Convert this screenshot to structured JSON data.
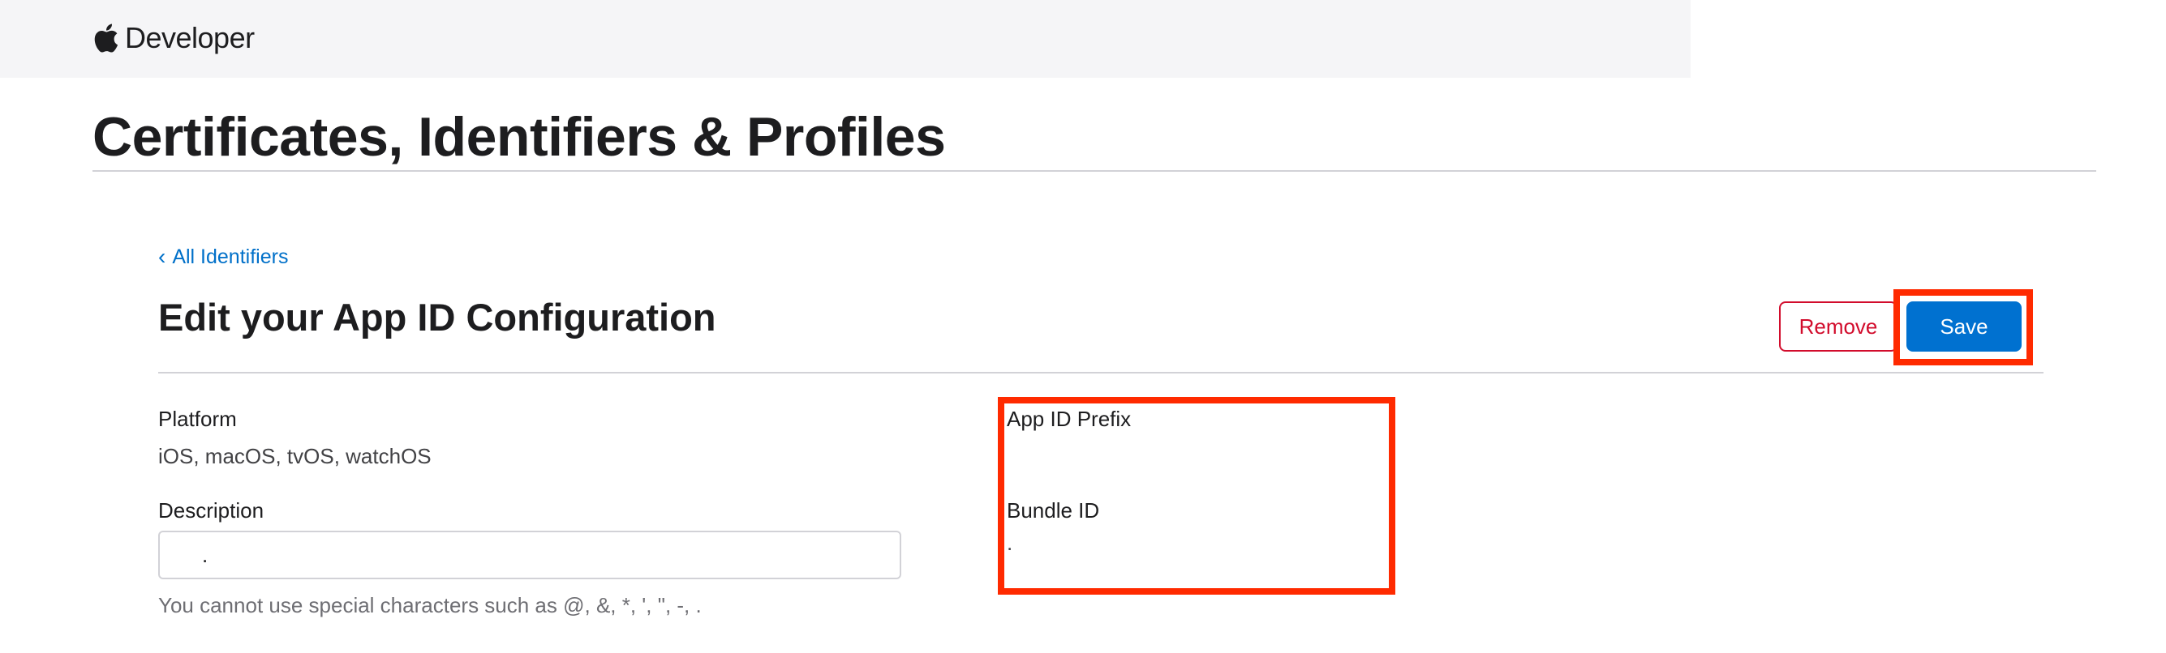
{
  "header": {
    "brand_label": "Developer",
    "logo_icon": "apple-logo-icon"
  },
  "page": {
    "title": "Certificates, Identifiers & Profiles"
  },
  "navigation": {
    "back_chevron": "‹",
    "back_label": "All Identifiers"
  },
  "section": {
    "title": "Edit your App ID Configuration"
  },
  "actions": {
    "remove_label": "Remove",
    "save_label": "Save"
  },
  "fields": {
    "platform_label": "Platform",
    "platform_value": "iOS, macOS, tvOS, watchOS",
    "description_label": "Description",
    "description_value": ".",
    "description_hint": "You cannot use special characters such as @, &, *, ', \", -, .",
    "app_id_prefix_label": "App ID Prefix",
    "app_id_prefix_value": "",
    "bundle_id_label": "Bundle ID",
    "bundle_id_value": "."
  },
  "colors": {
    "link": "#0070c9",
    "remove": "#d20c2c",
    "save_bg": "#0071d0",
    "annotation_box": "#ff2a00",
    "header_bg": "#f5f5f7"
  }
}
